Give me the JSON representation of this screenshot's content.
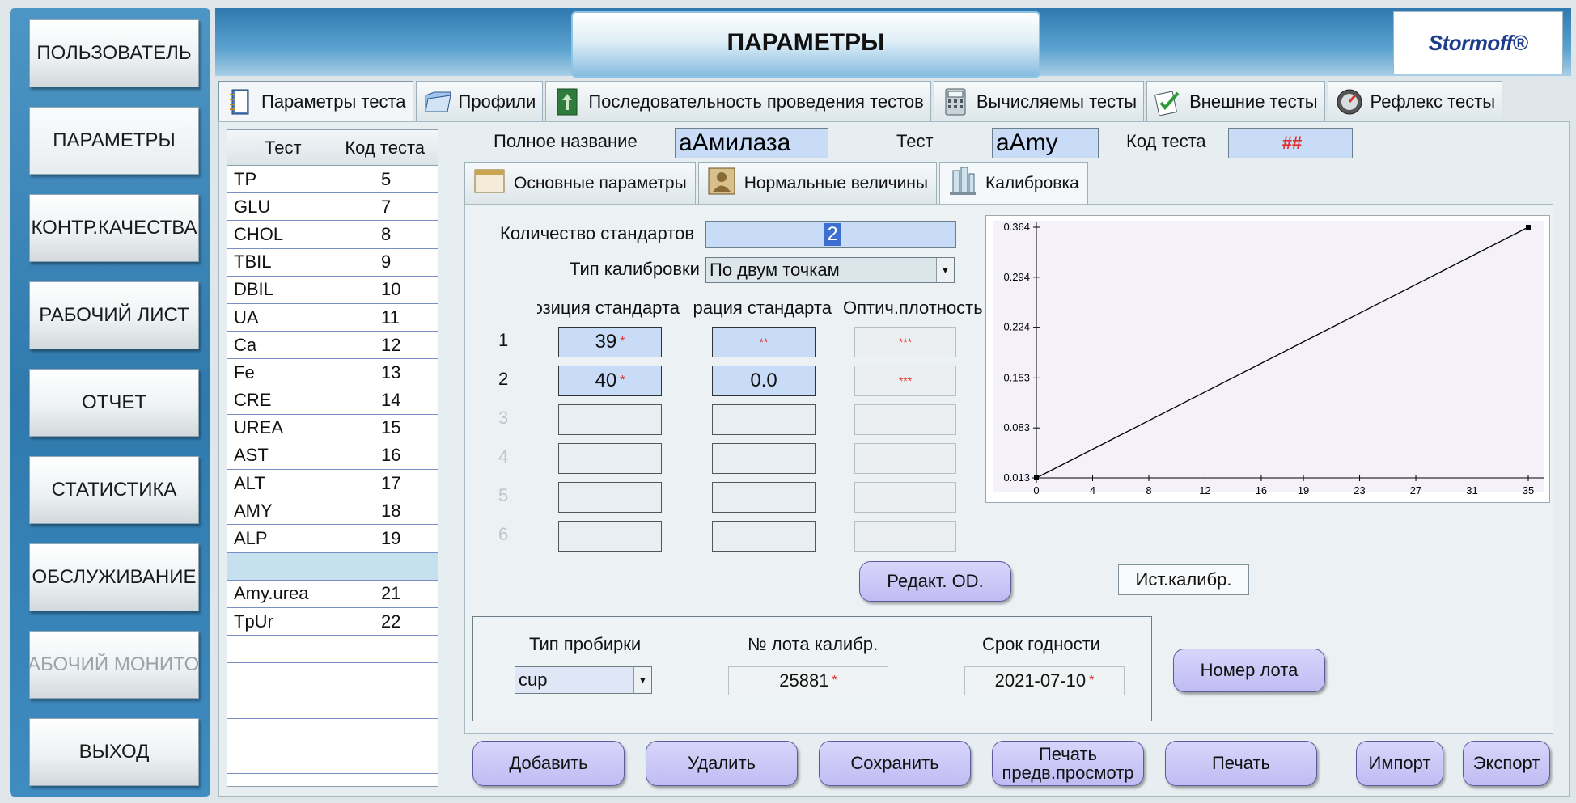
{
  "sidebar": {
    "items": [
      {
        "label": "ПОЛЬЗОВАТЕЛЬ",
        "state": "normal"
      },
      {
        "label": "ПАРАМЕТРЫ",
        "state": "active"
      },
      {
        "label": "КОНТР.КАЧЕСТВА",
        "state": "normal"
      },
      {
        "label": "РАБОЧИЙ ЛИСТ",
        "state": "normal"
      },
      {
        "label": "ОТЧЕТ",
        "state": "normal"
      },
      {
        "label": "СТАТИСТИКА",
        "state": "normal"
      },
      {
        "label": "ОБСЛУЖИВАНИЕ",
        "state": "normal"
      },
      {
        "label": "РАБОЧИЙ МОНИТОР",
        "state": "disabled"
      },
      {
        "label": "ВЫХОД",
        "state": "normal"
      }
    ]
  },
  "header": {
    "title": "ПАРАМЕТРЫ",
    "logo": "Stormoff®"
  },
  "top_tabs": [
    {
      "label": "Параметры теста",
      "icon": "book-icon"
    },
    {
      "label": "Профили",
      "icon": "folder-icon"
    },
    {
      "label": "Последовательность проведения тестов",
      "icon": "sequence-icon"
    },
    {
      "label": "Вычисляемы тесты",
      "icon": "calculator-icon"
    },
    {
      "label": "Внешние тесты",
      "icon": "checklist-icon"
    },
    {
      "label": "Рефлекс тесты",
      "icon": "gauge-icon"
    }
  ],
  "test_list": {
    "headers": [
      "Тест",
      "Код теста"
    ],
    "rows": [
      [
        "TP",
        "5"
      ],
      [
        "GLU",
        "7"
      ],
      [
        "CHOL",
        "8"
      ],
      [
        "TBIL",
        "9"
      ],
      [
        "DBIL",
        "10"
      ],
      [
        "UA",
        "11"
      ],
      [
        "Ca",
        "12"
      ],
      [
        "Fe",
        "13"
      ],
      [
        "CRE",
        "14"
      ],
      [
        "UREA",
        "15"
      ],
      [
        "AST",
        "16"
      ],
      [
        "ALT",
        "17"
      ],
      [
        "AMY",
        "18"
      ],
      [
        "ALP",
        "19"
      ],
      [
        "",
        ""
      ],
      [
        "Amy.urea",
        "21"
      ],
      [
        "TpUr",
        "22"
      ],
      [
        "",
        ""
      ],
      [
        "",
        ""
      ],
      [
        "",
        ""
      ],
      [
        "",
        ""
      ],
      [
        "",
        ""
      ],
      [
        "",
        ""
      ]
    ],
    "selected_index": 14
  },
  "test_info": {
    "full_name_label": "Полное название",
    "full_name_value": "аАмилаза",
    "test_label": "Тест",
    "test_value": "aAmy",
    "code_label": "Код теста",
    "code_value": "##"
  },
  "sub_tabs": [
    {
      "label": "Основные параметры",
      "icon": "window-icon"
    },
    {
      "label": "Нормальные величины",
      "icon": "person-icon"
    },
    {
      "label": "Калибровка",
      "icon": "flask-icon"
    }
  ],
  "calibration": {
    "std_count_label": "Количество стандартов",
    "std_count_value": "2",
    "type_label": "Тип калибровки",
    "type_value": "По двум точкам",
    "col_position": "Позиция стандарта",
    "col_conc": "Концентрация стандарта",
    "col_od": "Оптич.плотность",
    "rows": [
      {
        "num": "1",
        "position": "39",
        "conc": "**",
        "od": "***",
        "active": true
      },
      {
        "num": "2",
        "position": "40",
        "conc": "0.0",
        "od": "***",
        "active": true
      },
      {
        "num": "3",
        "position": "",
        "conc": "",
        "od": "",
        "active": false
      },
      {
        "num": "4",
        "position": "",
        "conc": "",
        "od": "",
        "active": false
      },
      {
        "num": "5",
        "position": "",
        "conc": "",
        "od": "",
        "active": false
      },
      {
        "num": "6",
        "position": "",
        "conc": "",
        "od": "",
        "active": false
      }
    ],
    "edit_od_button": "Редакт. OD.",
    "history_button": "Ист.калибр."
  },
  "lot": {
    "tube_type_label": "Тип пробирки",
    "tube_type_value": "cup",
    "lot_no_label": "№ лота калибр.",
    "lot_no_value": "25881",
    "expiry_label": "Срок годности",
    "expiry_value": "2021-07-10",
    "lot_button": "Номер лота"
  },
  "bottom_buttons": {
    "add": "Добавить",
    "delete": "Удалить",
    "save": "Сохранить",
    "print_preview_line1": "Печать",
    "print_preview_line2": "предв.просмотр",
    "print": "Печать",
    "import": "Импорт",
    "export": "Экспорт"
  },
  "chart_data": {
    "type": "line",
    "title": "",
    "xlabel": "",
    "ylabel": "",
    "x_ticks": [
      "0",
      "4",
      "8",
      "12",
      "16",
      "19",
      "23",
      "27",
      "31",
      "35"
    ],
    "y_ticks": [
      "0.013",
      "0.083",
      "0.153",
      "0.224",
      "0.294",
      "0.364"
    ],
    "xlim": [
      0,
      35
    ],
    "ylim": [
      0.013,
      0.364
    ],
    "series": [
      {
        "x": [
          0,
          35
        ],
        "y": [
          0.013,
          0.364
        ]
      }
    ]
  },
  "colors": {
    "field_blue": "#c9dcf7",
    "button_purple": "#c9c5f6",
    "header_blue": "#3f88bd",
    "required_red": "#e23030"
  }
}
